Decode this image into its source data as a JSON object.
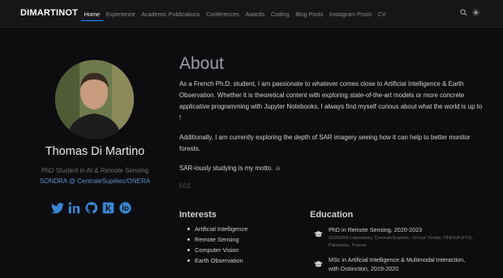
{
  "nav": {
    "brand": "DIMARTINOT",
    "links": [
      "Home",
      "Experience",
      "Academic Publications",
      "Conferences",
      "Awards",
      "Coding",
      "Blog Posts",
      "Instagram Posts",
      "CV"
    ],
    "active": "Home",
    "icons": [
      "search-icon",
      "theme-toggle-icon"
    ]
  },
  "profile": {
    "name": "Thomas Di Martino",
    "role": "PhD Student in AI & Remote Sensing",
    "org": "SONDRA @ CentraleSupélec/ONERA",
    "socials": [
      "twitter-icon",
      "linkedin-icon",
      "github-icon",
      "kaggle-icon",
      "orcid-icon"
    ]
  },
  "about": {
    "title": "About",
    "p1": "As a French Ph.D. student, I am passionate to whatever comes close to Artificial Intelligence & Earth Observation. Whether it is theoretical content with exploring state-of-the-art models or more concrete applicative programming with Jupyter Notebooks, I always find myself curious about what the world is up to !",
    "p2": "Additionally, I am currently exploring the depth of SAR imagery seeing how it can help to better monitor forests.",
    "p3": "SAR-iously studying is my motto. ☺",
    "dots": "▯▯▯"
  },
  "interests": {
    "title": "Interests",
    "items": [
      "Artificial Intelligence",
      "Remote Sensing",
      "Computer Vision",
      "Earth Observation"
    ]
  },
  "education": {
    "title": "Education",
    "items": [
      {
        "degree": "PhD in Remote Sensing, 2020-2023",
        "institution": "SONDRA Laboratory, CentraleSupélec, Gif-sur-Yvette; ONERA DTIS, Palaiseau, France"
      },
      {
        "degree": "MSc in Artificial Intelligence & Multimodal Interaction, with Distinction, 2019-2020",
        "institution": ""
      }
    ]
  },
  "colors": {
    "accent": "#1e90ff",
    "org_link": "#5d8fc4",
    "social": "#3a86d4",
    "background": "#0d0d10"
  }
}
